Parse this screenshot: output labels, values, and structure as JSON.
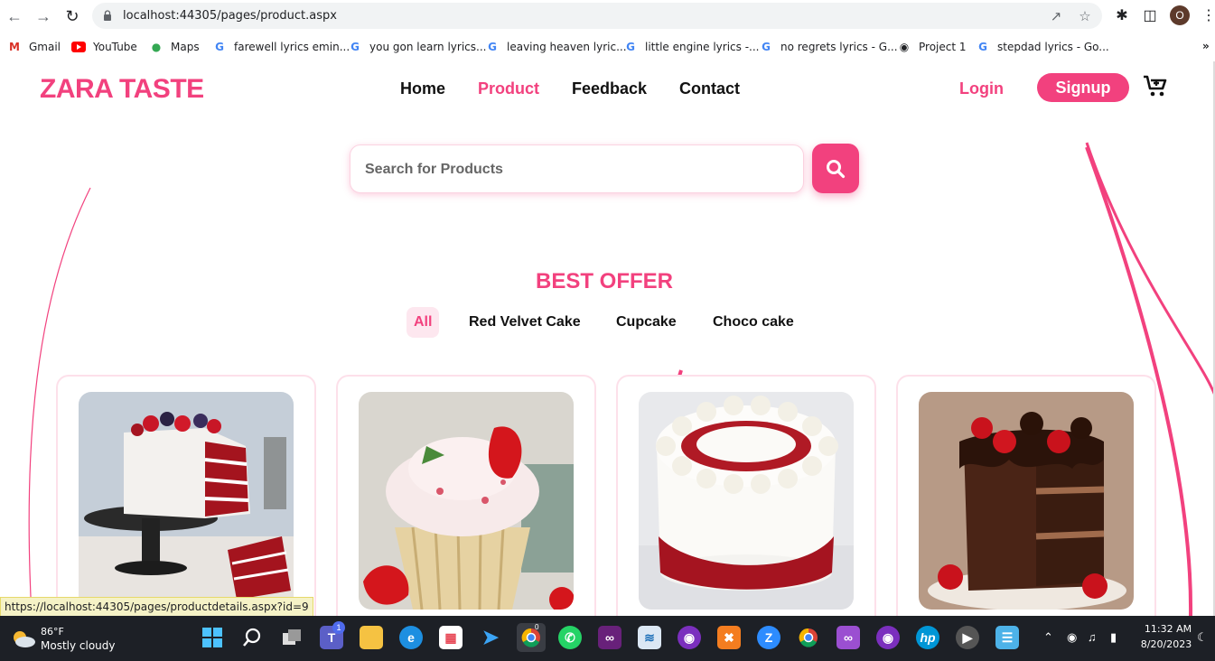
{
  "browser": {
    "url": "localhost:44305/pages/product.aspx",
    "profile_initial": "O",
    "bookmarks": [
      {
        "label": "Gmail",
        "icon": "gmail-icon"
      },
      {
        "label": "YouTube",
        "icon": "youtube-icon"
      },
      {
        "label": "Maps",
        "icon": "maps-icon"
      },
      {
        "label": "farewell lyrics emin...",
        "icon": "google-icon"
      },
      {
        "label": "you gon learn lyrics...",
        "icon": "google-icon"
      },
      {
        "label": "leaving heaven lyric...",
        "icon": "google-icon"
      },
      {
        "label": "little engine lyrics -...",
        "icon": "google-icon"
      },
      {
        "label": "no regrets lyrics - G...",
        "icon": "google-icon"
      },
      {
        "label": "Project 1",
        "icon": "globe-icon"
      },
      {
        "label": "stepdad lyrics - Go...",
        "icon": "google-icon"
      }
    ],
    "status_url": "https://localhost:44305/pages/productdetails.aspx?id=9"
  },
  "site": {
    "brand": "ZARA TASTE",
    "nav": [
      "Home",
      "Product",
      "Feedback",
      "Contact"
    ],
    "active_nav": "Product",
    "login": "Login",
    "signup": "Signup",
    "search_placeholder": "Search for Products",
    "section_title": "BEST OFFER",
    "filters": [
      "All",
      "Red Velvet Cake",
      "Cupcake",
      "Choco cake"
    ],
    "active_filter": "All",
    "products": [
      {
        "name": "red-velvet-layer-cake"
      },
      {
        "name": "strawberry-cupcake"
      },
      {
        "name": "red-velvet-round-cake"
      },
      {
        "name": "chocolate-strawberry-cake"
      }
    ],
    "colors": {
      "accent": "#f2417e",
      "accent_light": "#fde7ef"
    }
  },
  "taskbar": {
    "temp": "86°F",
    "weather": "Mostly cloudy",
    "time": "11:32 AM",
    "date": "8/20/2023",
    "chrome_badge": "0",
    "teams_badge": "1"
  }
}
